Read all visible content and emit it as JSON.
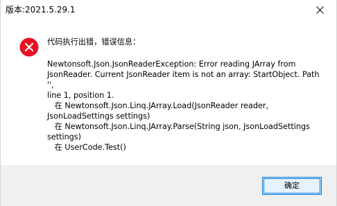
{
  "window": {
    "title": "版本:2021.5.29.1",
    "close_icon": "close-icon"
  },
  "message": {
    "icon": "error-icon",
    "icon_color": "#e81123",
    "heading": "代码执行出错，错误信息：",
    "body": "Newtonsoft.Json.JsonReaderException: Error reading JArray from\nJsonReader. Current JsonReader item is not an array: StartObject. Path '',\nline 1, position 1.\n   在 Newtonsoft.Json.Linq.JArray.Load(JsonReader reader,\nJsonLoadSettings settings)\n   在 Newtonsoft.Json.Linq.JArray.Parse(String json, JsonLoadSettings\nsettings)\n   在 UserCode.Test()"
  },
  "buttons": {
    "ok_label": "确定"
  },
  "colors": {
    "accent": "#0078d7",
    "footer_bg": "#f0f0f0"
  }
}
